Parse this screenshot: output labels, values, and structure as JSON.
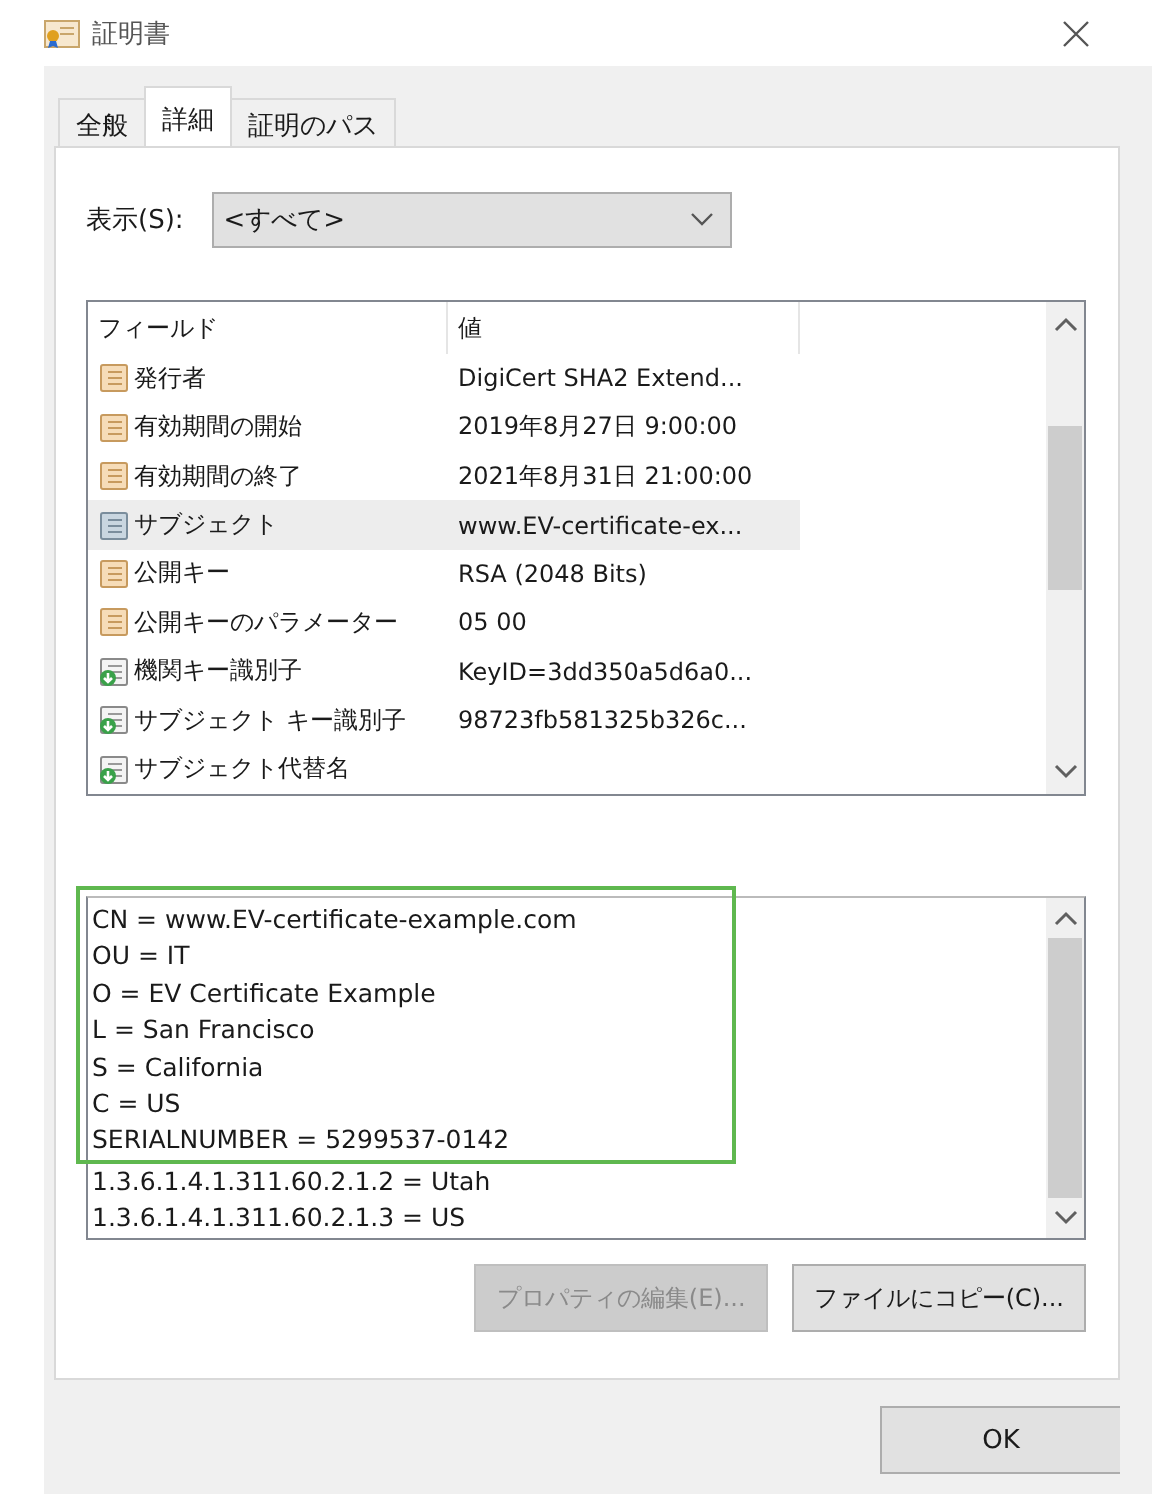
{
  "window": {
    "title": "証明書"
  },
  "tabs": [
    {
      "label": "全般",
      "selected": false
    },
    {
      "label": "詳細",
      "selected": true
    },
    {
      "label": "証明のパス",
      "selected": false
    }
  ],
  "show": {
    "label": "表示(S):",
    "value": "<すべて>"
  },
  "fields": {
    "columns": [
      "フィールド",
      "値"
    ],
    "rows": [
      {
        "kind": "property",
        "field": "発行者",
        "value": "DigiCert SHA2 Extend...",
        "selected": false
      },
      {
        "kind": "property",
        "field": "有効期間の開始",
        "value": "2019年8月27日 9:00:00",
        "selected": false
      },
      {
        "kind": "property",
        "field": "有効期間の終了",
        "value": "2021年8月31日 21:00:00",
        "selected": false
      },
      {
        "kind": "property",
        "field": "サブジェクト",
        "value": "www.EV-certificate-ex...",
        "selected": true
      },
      {
        "kind": "property",
        "field": "公開キー",
        "value": "RSA (2048 Bits)",
        "selected": false
      },
      {
        "kind": "property",
        "field": "公開キーのパラメーター",
        "value": "05 00",
        "selected": false
      },
      {
        "kind": "extension",
        "field": "機関キー識別子",
        "value": "KeyID=3dd350a5d6a0...",
        "selected": false
      },
      {
        "kind": "extension",
        "field": "サブジェクト キー識別子",
        "value": "98723fb581325b326c...",
        "selected": false
      },
      {
        "kind": "extension",
        "field": "サブジェクト代替名",
        "selected": false
      }
    ]
  },
  "detail": {
    "highlighted_lines": [
      "CN = www.EV-certificate-example.com",
      "OU = IT",
      "O = EV Certificate Example",
      "L = San Francisco",
      "S = California",
      "C = US",
      "SERIALNUMBER = 5299537-0142"
    ],
    "other_lines": [
      "1.3.6.1.4.1.311.60.2.1.2 = Utah",
      "1.3.6.1.4.1.311.60.2.1.3 = US"
    ]
  },
  "buttons": [
    {
      "label": "プロパティの編集(E)...",
      "disabled": true
    },
    {
      "label": "ファイルにコピー(C)...",
      "disabled": false
    }
  ],
  "footer": {
    "ok": "OK"
  }
}
